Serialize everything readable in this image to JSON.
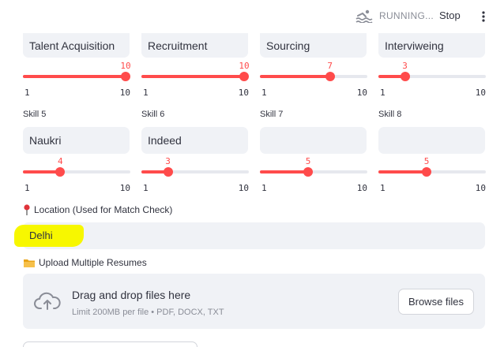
{
  "topbar": {
    "status_text": "RUNNING...",
    "stop_label": "Stop",
    "status_icon": "swimmer-icon",
    "menu_icon": "kebab-menu-icon"
  },
  "skills_row1": [
    {
      "value": "Talent Acquisition",
      "weight": "10",
      "min": "1",
      "max": "10"
    },
    {
      "value": "Recruitment",
      "weight": "10",
      "min": "1",
      "max": "10"
    },
    {
      "value": "Sourcing",
      "weight": "7",
      "min": "1",
      "max": "10"
    },
    {
      "value": "Interviweing",
      "weight": "3",
      "min": "1",
      "max": "10"
    }
  ],
  "skills_row2": [
    {
      "label": "Skill 5",
      "value": "Naukri",
      "weight": "4",
      "min": "1",
      "max": "10"
    },
    {
      "label": "Skill 6",
      "value": "Indeed",
      "weight": "3",
      "min": "1",
      "max": "10"
    },
    {
      "label": "Skill 7",
      "value": "",
      "weight": "5",
      "min": "1",
      "max": "10"
    },
    {
      "label": "Skill 8",
      "value": "",
      "weight": "5",
      "min": "1",
      "max": "10"
    }
  ],
  "location": {
    "label": "Location (Used for Match Check)",
    "icon": "pushpin-icon",
    "value": "Delhi"
  },
  "upload": {
    "label": "Upload Multiple Resumes",
    "icon": "folder-icon",
    "drop_title": "Drag and drop files here",
    "drop_sub": "Limit 200MB per file • PDF, DOCX, TXT",
    "browse_label": "Browse files",
    "cloud_icon": "cloud-upload-icon"
  },
  "colors": {
    "accent": "#ff4b4b",
    "highlight": "#f7f700"
  }
}
